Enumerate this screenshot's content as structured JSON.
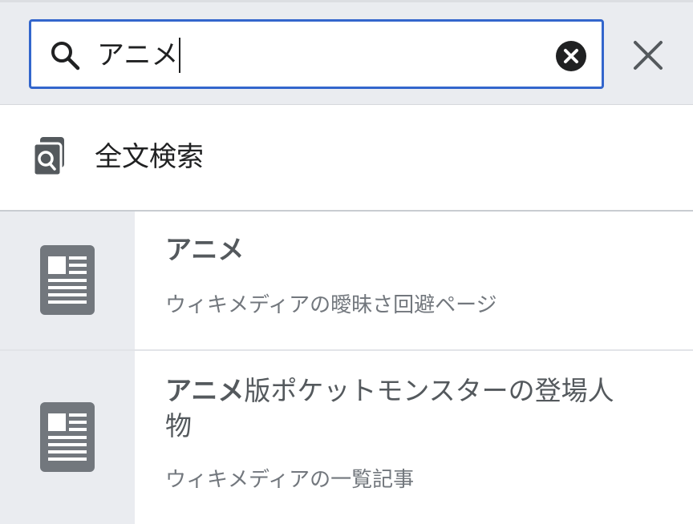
{
  "search": {
    "query": "アニメ",
    "placeholder": ""
  },
  "fulltext": {
    "label": "全文検索"
  },
  "results": [
    {
      "title_match": "アニメ",
      "title_rest": "",
      "description": "ウィキメディアの曖昧さ回避ページ"
    },
    {
      "title_match": "アニメ",
      "title_rest": "版ポケットモンスターの登場人物",
      "description": "ウィキメディアの一覧記事"
    }
  ],
  "colors": {
    "accent": "#3366cc",
    "toolbar_bg": "#eaecf0",
    "icon_gray": "#72777d",
    "text": "#202122"
  }
}
